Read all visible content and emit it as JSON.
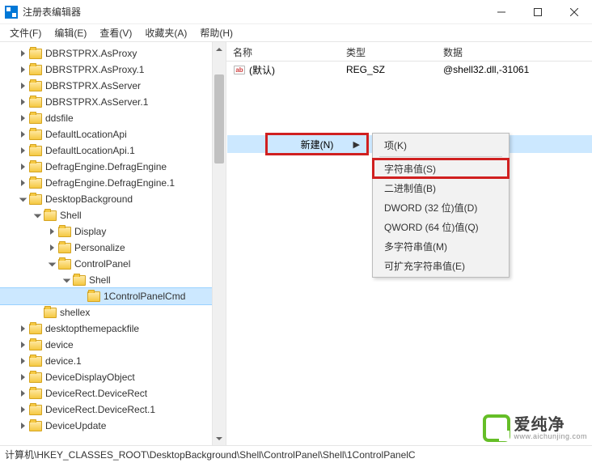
{
  "window": {
    "title": "注册表编辑器"
  },
  "menubar": {
    "file": "文件(F)",
    "edit": "编辑(E)",
    "view": "查看(V)",
    "favorites": "收藏夹(A)",
    "help": "帮助(H)"
  },
  "tree": [
    {
      "indent": 1,
      "exp": "collapsed",
      "label": "DBRSTPRX.AsProxy"
    },
    {
      "indent": 1,
      "exp": "collapsed",
      "label": "DBRSTPRX.AsProxy.1"
    },
    {
      "indent": 1,
      "exp": "collapsed",
      "label": "DBRSTPRX.AsServer"
    },
    {
      "indent": 1,
      "exp": "collapsed",
      "label": "DBRSTPRX.AsServer.1"
    },
    {
      "indent": 1,
      "exp": "collapsed",
      "label": "ddsfile"
    },
    {
      "indent": 1,
      "exp": "collapsed",
      "label": "DefaultLocationApi"
    },
    {
      "indent": 1,
      "exp": "collapsed",
      "label": "DefaultLocationApi.1"
    },
    {
      "indent": 1,
      "exp": "collapsed",
      "label": "DefragEngine.DefragEngine"
    },
    {
      "indent": 1,
      "exp": "collapsed",
      "label": "DefragEngine.DefragEngine.1"
    },
    {
      "indent": 1,
      "exp": "expanded",
      "label": "DesktopBackground"
    },
    {
      "indent": 2,
      "exp": "expanded",
      "label": "Shell"
    },
    {
      "indent": 3,
      "exp": "collapsed",
      "label": "Display"
    },
    {
      "indent": 3,
      "exp": "collapsed",
      "label": "Personalize"
    },
    {
      "indent": 3,
      "exp": "expanded",
      "label": "ControlPanel"
    },
    {
      "indent": 4,
      "exp": "expanded",
      "label": "Shell"
    },
    {
      "indent": 5,
      "exp": "none",
      "label": "1ControlPanelCmd",
      "selected": true
    },
    {
      "indent": 2,
      "exp": "none",
      "label": "shellex"
    },
    {
      "indent": 1,
      "exp": "collapsed",
      "label": "desktopthemepackfile"
    },
    {
      "indent": 1,
      "exp": "collapsed",
      "label": "device"
    },
    {
      "indent": 1,
      "exp": "collapsed",
      "label": "device.1"
    },
    {
      "indent": 1,
      "exp": "collapsed",
      "label": "DeviceDisplayObject"
    },
    {
      "indent": 1,
      "exp": "collapsed",
      "label": "DeviceRect.DeviceRect"
    },
    {
      "indent": 1,
      "exp": "collapsed",
      "label": "DeviceRect.DeviceRect.1"
    },
    {
      "indent": 1,
      "exp": "collapsed",
      "label": "DeviceUpdate"
    }
  ],
  "list": {
    "columns": {
      "name": "名称",
      "type": "类型",
      "data": "数据"
    },
    "rows": [
      {
        "name": "(默认)",
        "type": "REG_SZ",
        "data": "@shell32.dll,-31061"
      }
    ]
  },
  "context_menu": {
    "new_label": "新建(N)",
    "submenu": {
      "key": "项(K)",
      "string": "字符串值(S)",
      "binary": "二进制值(B)",
      "dword": "DWORD (32 位)值(D)",
      "qword": "QWORD (64 位)值(Q)",
      "multistring": "多字符串值(M)",
      "expandable": "可扩充字符串值(E)"
    }
  },
  "statusbar": {
    "path": "计算机\\HKEY_CLASSES_ROOT\\DesktopBackground\\Shell\\ControlPanel\\Shell\\1ControlPanelC"
  },
  "watermark": {
    "chinese": "爱纯净",
    "latin": "www.aichunjing.com"
  }
}
